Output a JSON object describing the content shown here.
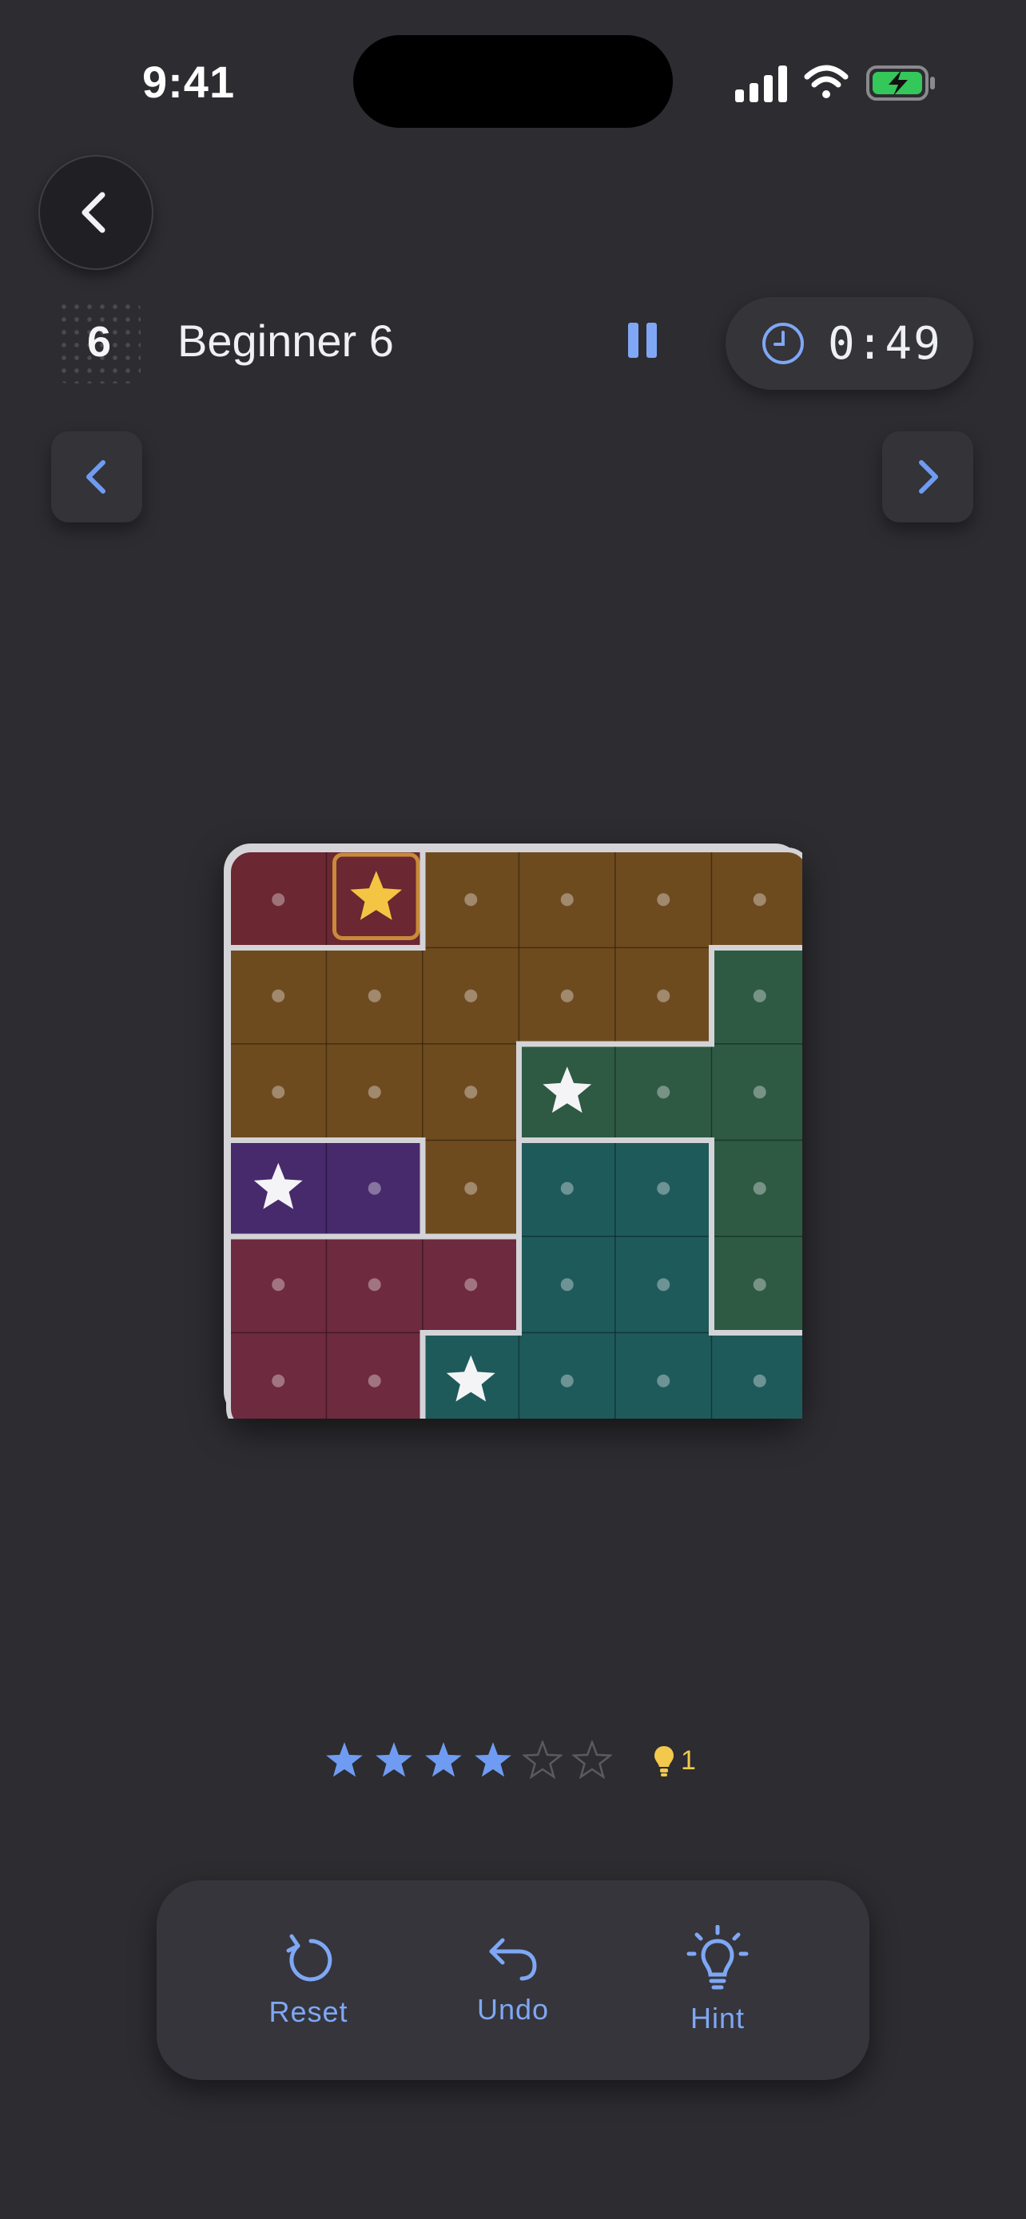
{
  "status": {
    "time": "9:41"
  },
  "header": {
    "level_number": "6",
    "level_title": "Beginner 6",
    "timer": "0:49"
  },
  "board": {
    "rows": 6,
    "cols": 6,
    "colors": {
      "A": "#6b2732",
      "B": "#6e4b1f",
      "C": "#2e5a44",
      "D": "#472a6c",
      "E": "#6e2a3e",
      "F": "#1f5a5b"
    },
    "grid": [
      [
        "A",
        "A",
        "B",
        "B",
        "B",
        "B"
      ],
      [
        "B",
        "B",
        "B",
        "B",
        "B",
        "C"
      ],
      [
        "B",
        "B",
        "B",
        "C",
        "C",
        "C"
      ],
      [
        "D",
        "D",
        "B",
        "F",
        "F",
        "C"
      ],
      [
        "E",
        "E",
        "E",
        "F",
        "F",
        "C"
      ],
      [
        "E",
        "E",
        "F",
        "F",
        "F",
        "F"
      ]
    ],
    "stars": [
      {
        "row": 0,
        "col": 1,
        "style": "gold-selected"
      },
      {
        "row": 2,
        "col": 3,
        "style": "white"
      },
      {
        "row": 3,
        "col": 0,
        "style": "white"
      },
      {
        "row": 5,
        "col": 2,
        "style": "white"
      }
    ]
  },
  "rating": {
    "filled": 4,
    "total": 6,
    "accent": "#6f9cf2"
  },
  "hints": {
    "count": "1"
  },
  "toolbar": {
    "reset_label": "Reset",
    "undo_label": "Undo",
    "hint_label": "Hint"
  },
  "accent_color": "#7fa7f5"
}
